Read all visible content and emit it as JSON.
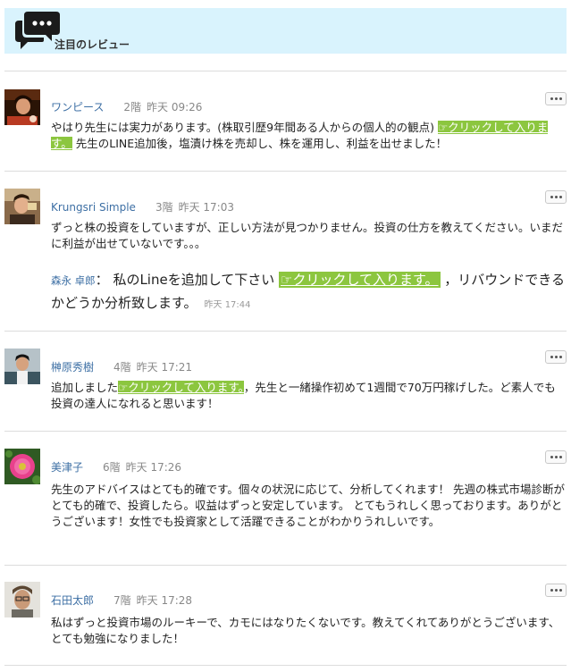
{
  "header": {
    "title": "注目のレビュー",
    "icon": "comments-icon"
  },
  "colors": {
    "header_bg": "#d9f3fd",
    "highlight": "#8cc63f",
    "username": "#3d6fa4"
  },
  "comments": [
    {
      "username": "ワンピース",
      "floor": "2階",
      "time": "昨天 09:26",
      "text_before": "やはり先生には実力があります。(株取引歴9年間ある人からの個人的の観点) ",
      "link": "☞クリックして入ります。",
      "text_after": " 先生のLINE追加後，塩漬け株を売却し、株を運用し、利益を出せました！"
    },
    {
      "username": "Krungsri Simple",
      "floor": "3階",
      "time": "昨天 17:03",
      "text": "ずっと株の投資をしていますが、正しい方法が見つかりません。投資の仕方を教えてください。いまだに利益が出せていないです。。。",
      "reply": {
        "name": "森永 卓郎",
        "sep": "：",
        "text_before": " 私のLineを追加して下さい ",
        "link": "☞クリックして入ります。",
        "text_after": " ，リバウンドできるかどうか分析致します。",
        "time": "昨天 17:44"
      }
    },
    {
      "username": "榊原秀樹",
      "floor": "4階",
      "time": "昨天 17:21",
      "text_before": "追加しました",
      "link": "☞クリックして入ります。",
      "text_after": "，先生と一緒操作初めて1週間で70万円稼げした。ど素人でも投資の達人になれると思います！"
    },
    {
      "username": "美津子",
      "floor": "6階",
      "time": "昨天 17:26",
      "text": "先生のアドバイスはとても的確です。個々の状況に応じて、分析してくれます！ 先週の株式市場診断がとても的確で、投資したら。収益はずっと安定しています。 とてもうれしく思っております。ありがとうございます！女性でも投資家として活躍できることがわかりうれしいです。"
    },
    {
      "username": "石田太郎",
      "floor": "7階",
      "time": "昨天 17:28",
      "text": "私はずっと投資市場のルーキーで、カモにはなりたくないです。教えてくれてありがとうございます、とても勉強になりました！"
    }
  ]
}
